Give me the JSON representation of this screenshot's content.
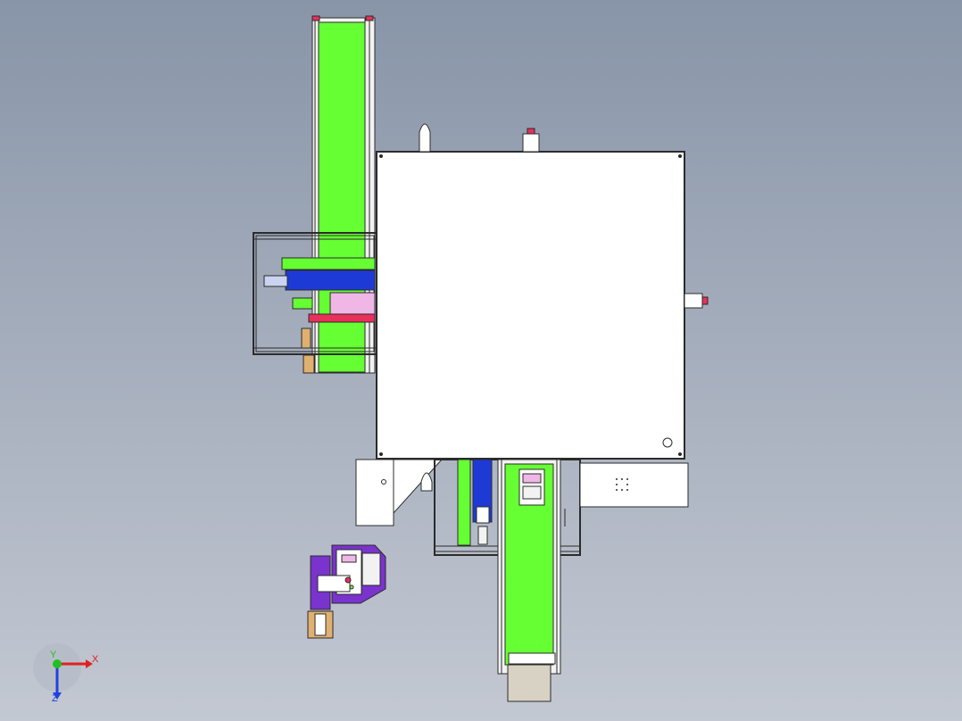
{
  "viewport": {
    "background_top": "#8895a8",
    "background_bottom": "#c3c8d2"
  },
  "model_colors": {
    "conveyor_belt": "#66ff33",
    "frame": "#f2f2f2",
    "cylinder_blue": "#1e3ad6",
    "bracket_purple": "#7a33cc",
    "rail_red": "#e8305a",
    "plate_pink": "#f0b6e6",
    "bearing_orange": "#e0b070",
    "cover_panel": "#ffffff",
    "chute_tan": "#d8d2c4",
    "outline": "#2b2b2b"
  },
  "triad": {
    "x_label": "X",
    "y_label": "Y",
    "z_label": "Z",
    "x_color": "#e02020",
    "y_color": "#20c020",
    "z_color": "#2040e0"
  }
}
